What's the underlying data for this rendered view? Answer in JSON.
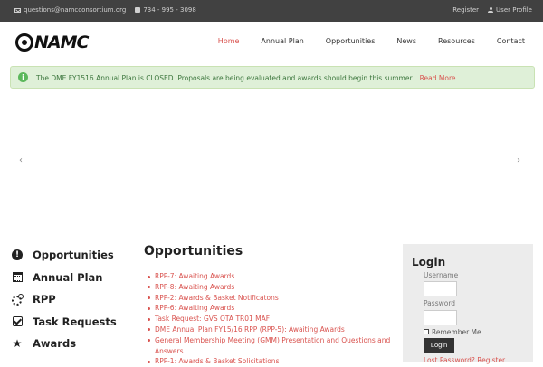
{
  "topbar": {
    "email": "questions@namcconsortium.org",
    "phone": "734 - 995 - 3098",
    "register": "Register",
    "profile": "User Profile"
  },
  "header": {
    "logo_text": "NAMC",
    "nav": [
      "Home",
      "Annual Plan",
      "Opportunities",
      "News",
      "Resources",
      "Contact"
    ],
    "active_nav": "Home"
  },
  "alert": {
    "message": "The DME FY1516 Annual Plan is CLOSED. Proposals are being evaluated and awards should begin this summer.",
    "link": "Read More..."
  },
  "carousel": {
    "prev": "‹",
    "next": "›"
  },
  "sidebar": {
    "items": [
      {
        "label": "Opportunities",
        "icon": "exclamation-circle-icon"
      },
      {
        "label": "Annual Plan",
        "icon": "calendar-icon"
      },
      {
        "label": "RPP",
        "icon": "gears-icon"
      },
      {
        "label": "Task Requests",
        "icon": "check-square-icon"
      },
      {
        "label": "Awards",
        "icon": "star-icon"
      }
    ]
  },
  "content": {
    "title": "Opportunities",
    "items": [
      "RPP-7: Awaiting Awards",
      "RPP-8: Awaiting Awards",
      "RPP-2: Awards & Basket Notificatons",
      "RPP-6: Awaiting Awards",
      "Task Request: GVS OTA TR01 MAF",
      "DME Annual Plan FY15/16 RPP (RPP-5): Awaiting Awards",
      "General Membership Meeting (GMM) Presentation and Questions and Answers",
      "RPP-1: Awards & Basket Solicitations"
    ]
  },
  "login": {
    "title": "Login",
    "username_label": "Username",
    "password_label": "Password",
    "remember_label": "Remember Me",
    "button": "Login",
    "lost_link": "Lost Password? Register"
  },
  "colors": {
    "topbar_bg": "#414141",
    "accent": "#d9534f",
    "alert_bg": "#dff0d8",
    "alert_text": "#3c763d",
    "login_bg": "#ececec"
  }
}
